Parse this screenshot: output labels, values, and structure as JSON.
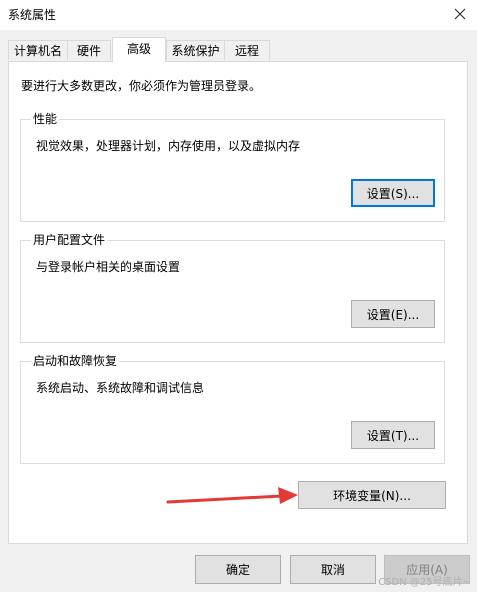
{
  "window": {
    "title": "系统属性",
    "close_icon": "close-icon"
  },
  "tabs": [
    {
      "label": "计算机名",
      "active": false
    },
    {
      "label": "硬件",
      "active": false
    },
    {
      "label": "高级",
      "active": true
    },
    {
      "label": "系统保护",
      "active": false
    },
    {
      "label": "远程",
      "active": false
    }
  ],
  "intro": "要进行大多数更改，你必须作为管理员登录。",
  "performance": {
    "title": "性能",
    "description": "视觉效果，处理器计划，内存使用，以及虚拟内存",
    "button": "设置(S)..."
  },
  "user_profiles": {
    "title": "用户配置文件",
    "description": "与登录帐户相关的桌面设置",
    "button": "设置(E)..."
  },
  "startup_recovery": {
    "title": "启动和故障恢复",
    "description": "系统启动、系统故障和调试信息",
    "button": "设置(T)..."
  },
  "env_vars_button": "环境变量(N)...",
  "footer": {
    "ok": "确定",
    "cancel": "取消",
    "apply": "应用(A)"
  },
  "annotation": {
    "arrow_color": "#e53935"
  },
  "watermark": "CSDN @25号底片~"
}
